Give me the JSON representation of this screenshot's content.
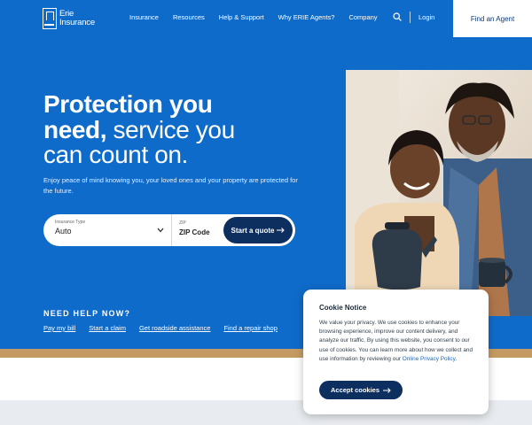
{
  "header": {
    "logo_line1": "Erie",
    "logo_line2": "Insurance",
    "nav": [
      "Insurance",
      "Resources",
      "Help & Support",
      "Why ERIE Agents?",
      "Company"
    ],
    "login": "Login",
    "find_agent": "Find an Agent"
  },
  "hero": {
    "headline_bold1": "Protection you",
    "headline_bold2": "need,",
    "headline_light2": "service you",
    "headline_light3": "can count on.",
    "subtext": "Enjoy peace of mind knowing you, your loved ones and your property are protected for the future."
  },
  "quote_form": {
    "type_label": "Insurance Type",
    "type_value": "Auto",
    "zip_label": "ZIP",
    "zip_value": "ZIP Code",
    "button": "Start a quote"
  },
  "help": {
    "title": "NEED HELP NOW?",
    "links": [
      "Pay my bill",
      "Start a claim",
      "Get roadside assistance",
      "Find a repair shop"
    ]
  },
  "cookie": {
    "title": "Cookie Notice",
    "body": "We value your privacy. We use cookies to enhance your browsing experience, improve our content delivery, and analyze our traffic. By using this website, you consent to our use of cookies. You can learn more about how we collect and use information by reviewing our",
    "link": "Online Privacy Policy",
    "period": ".",
    "button": "Accept cookies"
  },
  "colors": {
    "brand_blue": "#0f6bc9",
    "navy": "#0d2f5f",
    "tan": "#c59b63"
  }
}
